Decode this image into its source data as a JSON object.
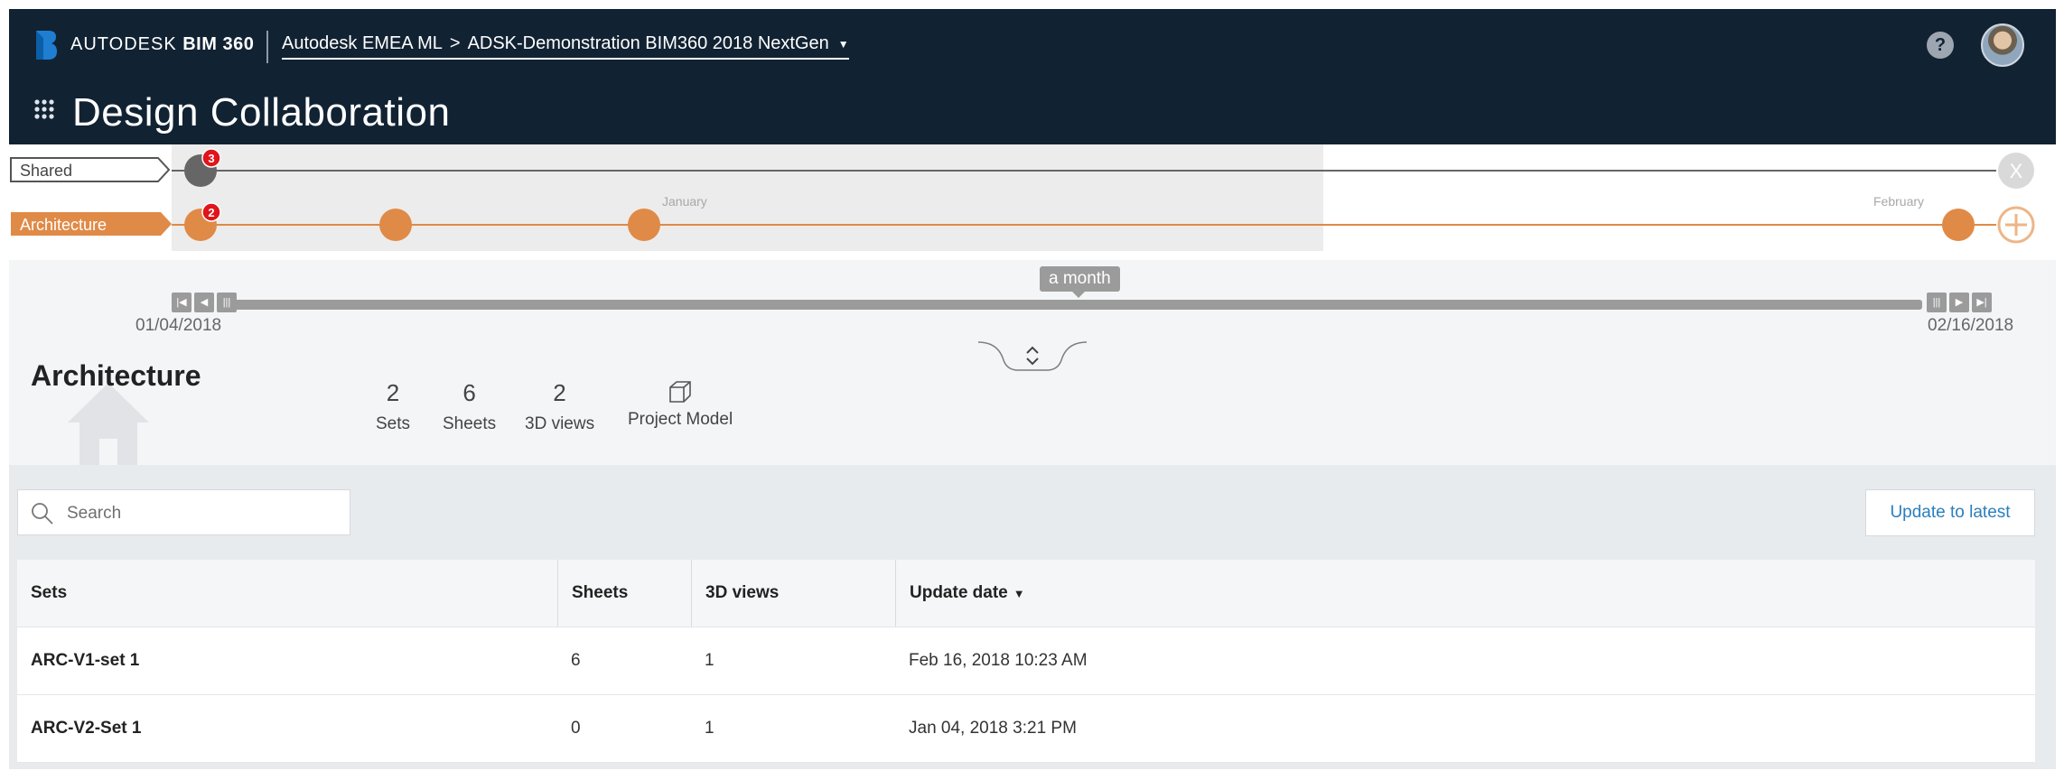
{
  "header": {
    "brand_prefix": "AUTODESK",
    "brand_product": "BIM 360",
    "breadcrumb_account": "Autodesk EMEA ML",
    "breadcrumb_separator": ">",
    "breadcrumb_project": "ADSK-Demonstration BIM360 2018 NextGen",
    "help_label": "?",
    "app_title": "Design Collaboration"
  },
  "timeline": {
    "tracks": [
      {
        "label": "Shared",
        "badge": "3",
        "color": "#555555"
      },
      {
        "label": "Architecture",
        "badge": "2",
        "color": "#e08a47"
      }
    ],
    "month_labels": [
      "January",
      "February"
    ],
    "close_label": "X",
    "add_label": "+"
  },
  "slider": {
    "range_label": "a month",
    "start_date": "01/04/2018",
    "end_date": "02/16/2018"
  },
  "summary": {
    "title": "Architecture",
    "stats": [
      {
        "value": "2",
        "label": "Sets"
      },
      {
        "value": "6",
        "label": "Sheets"
      },
      {
        "value": "2",
        "label": "3D views"
      },
      {
        "value": "",
        "label": "Project Model"
      }
    ]
  },
  "search": {
    "placeholder": "Search"
  },
  "update_button": "Update to latest",
  "table": {
    "columns": [
      "Sets",
      "Sheets",
      "3D views",
      "Update date"
    ],
    "rows": [
      {
        "set": "ARC-V1-set 1",
        "sheets": "6",
        "views": "1",
        "date": "Feb 16, 2018 10:23 AM"
      },
      {
        "set": "ARC-V2-Set 1",
        "sheets": "0",
        "views": "1",
        "date": "Jan 04, 2018 3:21 PM"
      }
    ]
  },
  "colors": {
    "header_bg": "#112233",
    "arch_orange": "#e08a47",
    "link_blue": "#2b7fbd",
    "badge_red": "#e0151b"
  },
  "icons": [
    "autodesk-b-logo-icon",
    "help-icon",
    "avatar",
    "app-grid-icon",
    "close-icon",
    "add-icon",
    "house-icon",
    "cube-icon",
    "search-icon",
    "chevron-down-icon",
    "collapse-icon"
  ]
}
